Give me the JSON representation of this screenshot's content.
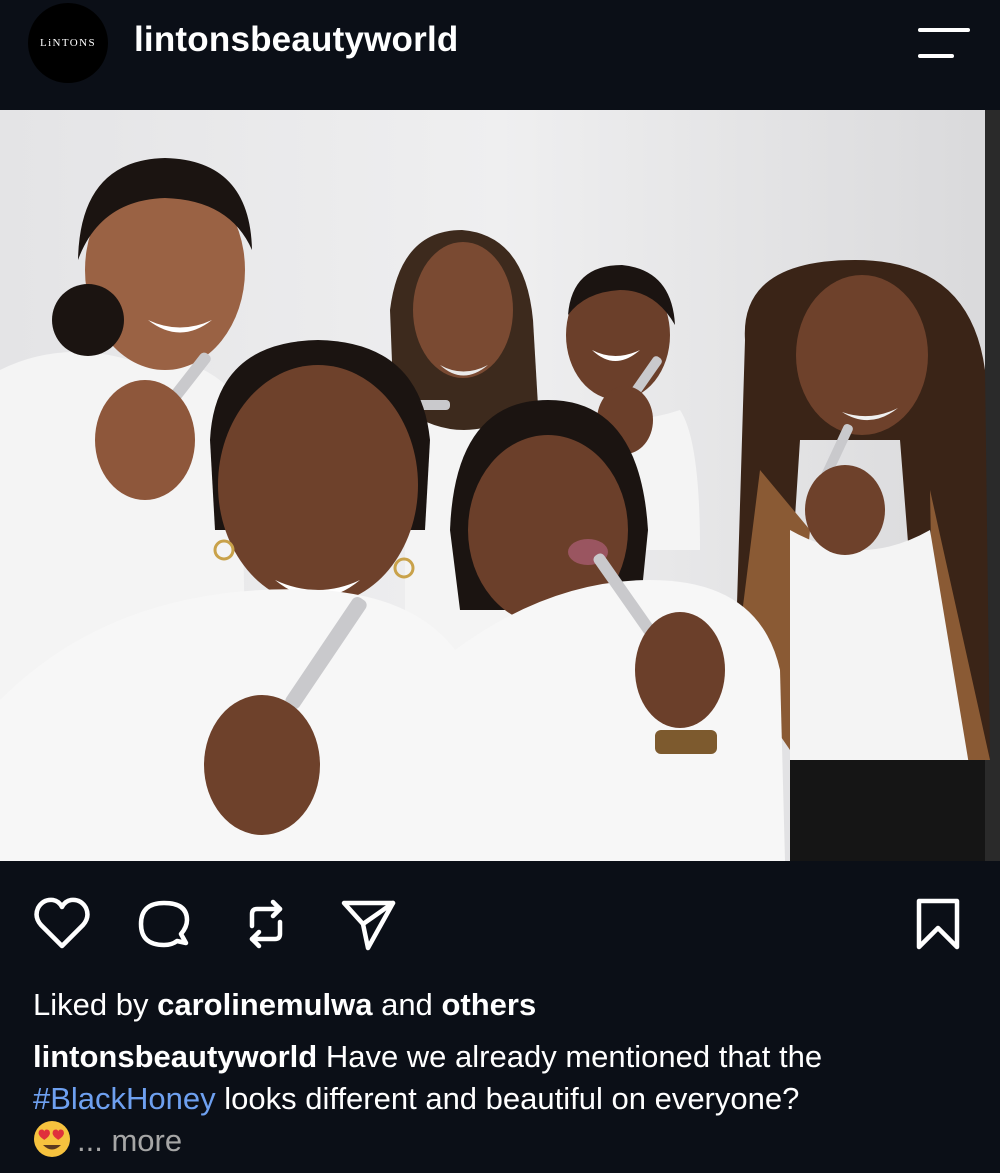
{
  "header": {
    "avatar_text": "LiNTONS",
    "username": "lintonsbeautyworld"
  },
  "post": {
    "image_alt": "Six smiling women in white t-shirts holding silver lip products"
  },
  "actions": {
    "like_icon": "heart-icon",
    "comment_icon": "comment-icon",
    "repost_icon": "repost-icon",
    "share_icon": "send-icon",
    "save_icon": "bookmark-icon"
  },
  "likes": {
    "prefix": "Liked by",
    "user": "carolinemulwa",
    "and": "and",
    "others": "others"
  },
  "caption": {
    "username": "lintonsbeautyworld",
    "text_before": "Have we already mentioned that the",
    "hashtag": "#BlackHoney",
    "text_after": "looks different and beautiful on everyone?",
    "emoji": "heart-eyes-emoji",
    "more": "... more"
  },
  "colors": {
    "background": "#0b0f17",
    "hashtag": "#6ea0f0",
    "muted": "#a6a6a6"
  }
}
